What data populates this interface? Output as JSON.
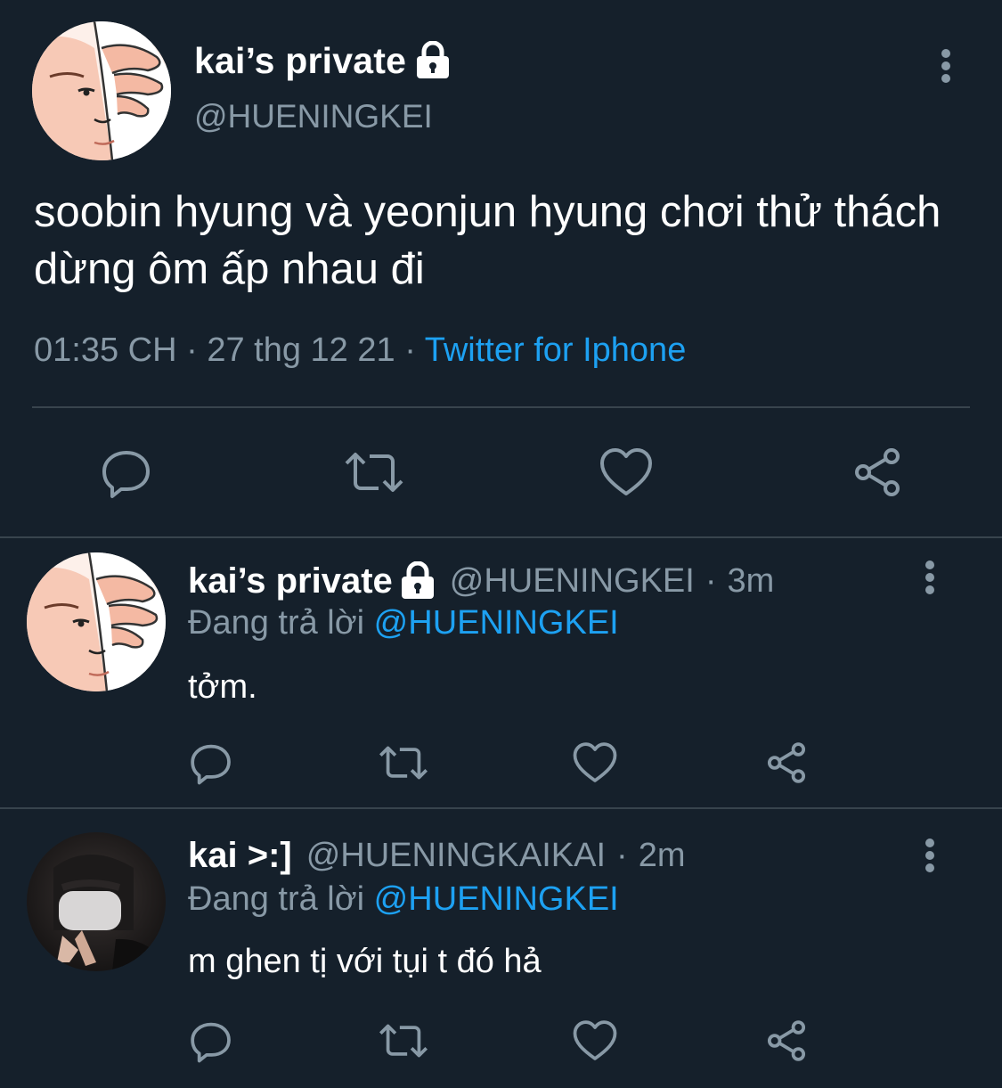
{
  "colors": {
    "background": "#15202b",
    "secondary_text": "#8899a6",
    "accent": "#1da1f2",
    "divider": "#38444d"
  },
  "main_tweet": {
    "display_name": "kai’s private",
    "handle": "@HUENINGKEI",
    "text": "soobin hyung và yeonjun hyung chơi thử thách dừng ôm ấp nhau đi",
    "time": "01:35 CH",
    "date": "27 thg 12 21",
    "source": "Twitter for Iphone",
    "icons": [
      "lock-icon",
      "more-vertical-icon",
      "reply-icon",
      "retweet-icon",
      "like-icon",
      "share-icon"
    ]
  },
  "replies": [
    {
      "display_name": "kai’s private",
      "protected": true,
      "handle": "@HUENINGKEI",
      "time": "3m",
      "replying_label": "Đang trả lời",
      "replying_to": "@HUENINGKEI",
      "text": "tởm."
    },
    {
      "display_name": "kai >:]",
      "protected": false,
      "handle": "@HUENINGKAIKAI",
      "time": "2m",
      "replying_label": "Đang trả lời",
      "replying_to": "@HUENINGKEI",
      "text": "m ghen tị với tụi t đó hả"
    }
  ],
  "separators": {
    "dot": "·"
  }
}
